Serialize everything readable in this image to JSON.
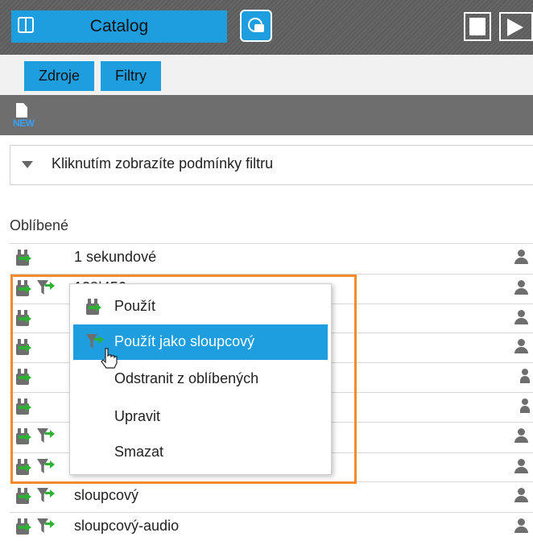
{
  "titlebar": {
    "catalog_tab": "Catalog",
    "icons": [
      "catalog-book-icon",
      "data-sources-icon",
      "stop-icon",
      "play-icon"
    ]
  },
  "nav": {
    "sources": "Zdroje",
    "filters": "Filtry"
  },
  "toolbar": {
    "new_label": "NEW"
  },
  "filter_bar": {
    "text": "Kliknutím zobrazíte podmínky filtru"
  },
  "favorites": {
    "heading": "Oblíbené",
    "rows": [
      {
        "label": "1 sekundové",
        "icons": [
          "apply"
        ],
        "owner": "user"
      },
      {
        "label": "128|456",
        "icons": [
          "apply",
          "funnel"
        ],
        "owner": "user"
      },
      {
        "label": "",
        "icons": [
          "apply"
        ],
        "owner": "user"
      },
      {
        "label": "",
        "icons": [
          "apply"
        ],
        "owner": "user"
      },
      {
        "label": "",
        "icons": [
          "apply"
        ],
        "owner": "group"
      },
      {
        "label": "",
        "icons": [
          "apply"
        ],
        "owner": "group"
      },
      {
        "label": "",
        "icons": [
          "apply",
          "funnel"
        ],
        "owner": "user"
      },
      {
        "label": "",
        "icons": [
          "apply",
          "funnel"
        ],
        "owner": "user"
      },
      {
        "label": "sloupcový",
        "icons": [
          "apply",
          "funnel"
        ],
        "owner": "user"
      },
      {
        "label": "sloupcový-audio",
        "icons": [
          "apply",
          "funnel"
        ],
        "owner": "user"
      }
    ]
  },
  "context_menu": {
    "items": [
      {
        "label": "Použít",
        "icon": "apply-filter-icon"
      },
      {
        "label": "Použít jako sloupcový",
        "icon": "apply-as-column-icon",
        "active": true
      },
      {
        "label": "Odstranit z oblíbených"
      },
      {
        "label": "Upravit"
      },
      {
        "label": "Smazat"
      }
    ]
  },
  "colors": {
    "accent": "#1e9ede",
    "highlight_outline": "#f28a2b",
    "apply_green": "#2eb135"
  }
}
